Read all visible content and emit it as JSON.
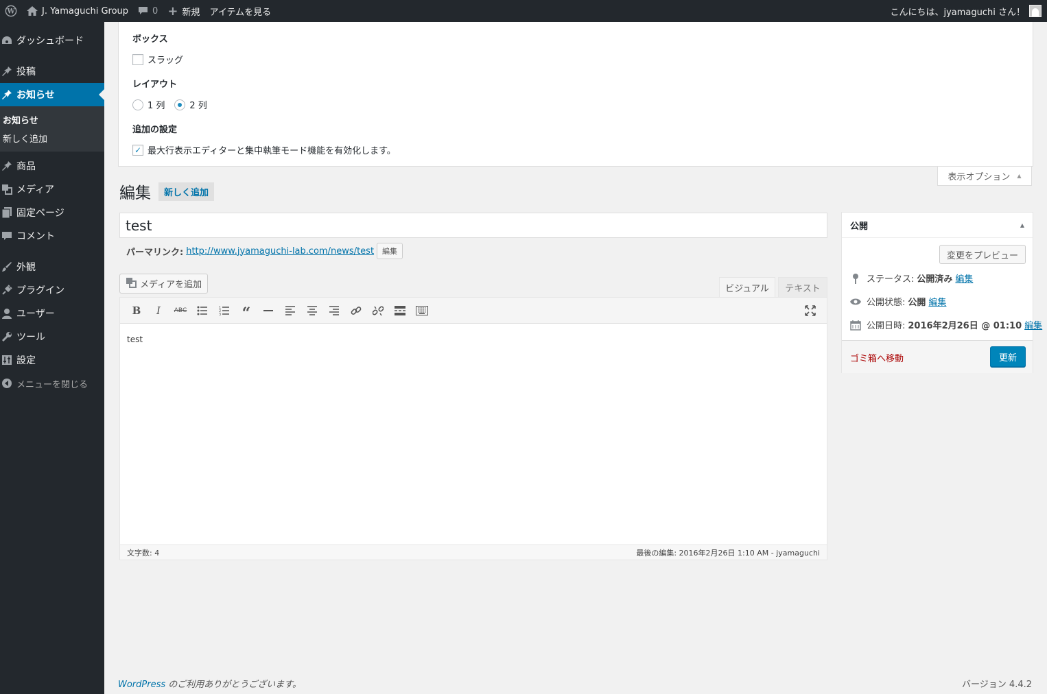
{
  "adminbar": {
    "site_name": "J. Yamaguchi Group",
    "comments_count": "0",
    "new_label": "新規",
    "view_item": "アイテムを見る",
    "greeting": "こんにちは、jyamaguchi さん！"
  },
  "sidebar": {
    "items": [
      {
        "label": "ダッシュボード",
        "icon": "dashboard-icon"
      },
      {
        "label": "投稿",
        "icon": "pin-icon"
      },
      {
        "label": "お知らせ",
        "icon": "pin-icon"
      },
      {
        "label": "商品",
        "icon": "pin-icon"
      },
      {
        "label": "メディア",
        "icon": "media-icon"
      },
      {
        "label": "固定ページ",
        "icon": "page-icon"
      },
      {
        "label": "コメント",
        "icon": "comment-icon"
      },
      {
        "label": "外観",
        "icon": "brush-icon"
      },
      {
        "label": "プラグイン",
        "icon": "plugin-icon"
      },
      {
        "label": "ユーザー",
        "icon": "user-icon"
      },
      {
        "label": "ツール",
        "icon": "wrench-icon"
      },
      {
        "label": "設定",
        "icon": "settings-icon"
      }
    ],
    "submenu": [
      "お知らせ",
      "新しく追加"
    ],
    "collapse": "メニューを閉じる"
  },
  "screen_options": {
    "boxes_heading": "ボックス",
    "slug_label": "スラッグ",
    "layout_heading": "レイアウト",
    "col1_label": "1 列",
    "col2_label": "2 列",
    "extra_heading": "追加の設定",
    "editor_expand_label": "最大行表示エディターと集中執筆モード機能を有効化します。",
    "tab_label": "表示オプション"
  },
  "heading": {
    "title": "編集",
    "add_new": "新しく追加"
  },
  "post": {
    "title": "test",
    "permalink_label": "パーマリンク:",
    "permalink_url": "http://www.jyamaguchi-lab.com/news/test",
    "permalink_edit": "編集"
  },
  "editor": {
    "add_media": "メディアを追加",
    "tab_visual": "ビジュアル",
    "tab_text": "テキスト",
    "content": "test",
    "word_count": "文字数: 4",
    "last_edit": "最後の編集: 2016年2月26日 1:10 AM - jyamaguchi"
  },
  "publish": {
    "title": "公開",
    "preview": "変更をプレビュー",
    "status_label": "ステータス:",
    "status_value": "公開済み",
    "status_edit": "編集",
    "visibility_label": "公開状態:",
    "visibility_value": "公開",
    "visibility_edit": "編集",
    "date_label": "公開日時:",
    "date_value": "2016年2月26日 @ 01:10",
    "date_edit": "編集",
    "trash": "ゴミ箱へ移動",
    "update": "更新"
  },
  "footer": {
    "wp_link": "WordPress",
    "thanks": " のご利用ありがとうございます。",
    "version": "バージョン 4.4.2"
  }
}
